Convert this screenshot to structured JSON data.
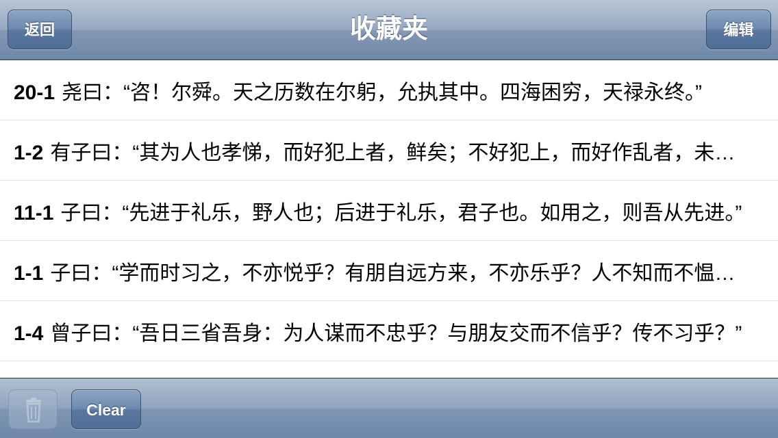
{
  "navbar": {
    "title": "收藏夹",
    "back_label": "返回",
    "edit_label": "编辑"
  },
  "favorites": [
    {
      "number": "20-1",
      "text": "尧曰：“咨！尔舜。天之历数在尔躬，允执其中。四海困穷，天禄永终。”"
    },
    {
      "number": "1-2",
      "text": "有子曰：“其为人也孝悌，而好犯上者，鲜矣；不好犯上，而好作乱者，未之有也。”"
    },
    {
      "number": "11-1",
      "text": "子曰：“先进于礼乐，野人也；后进于礼乐，君子也。如用之，则吾从先进。”"
    },
    {
      "number": "1-1",
      "text": "子曰：“学而时习之，不亦悦乎？有朋自远方来，不亦乐乎？人不知而不愠，不亦君子乎？”"
    },
    {
      "number": "1-4",
      "text": "曾子曰：“吾日三省吾身：为人谋而不忠乎？与朋友交而不信乎？传不习乎？”"
    }
  ],
  "toolbar": {
    "trash_icon": "trash-icon",
    "clear_label": "Clear"
  }
}
